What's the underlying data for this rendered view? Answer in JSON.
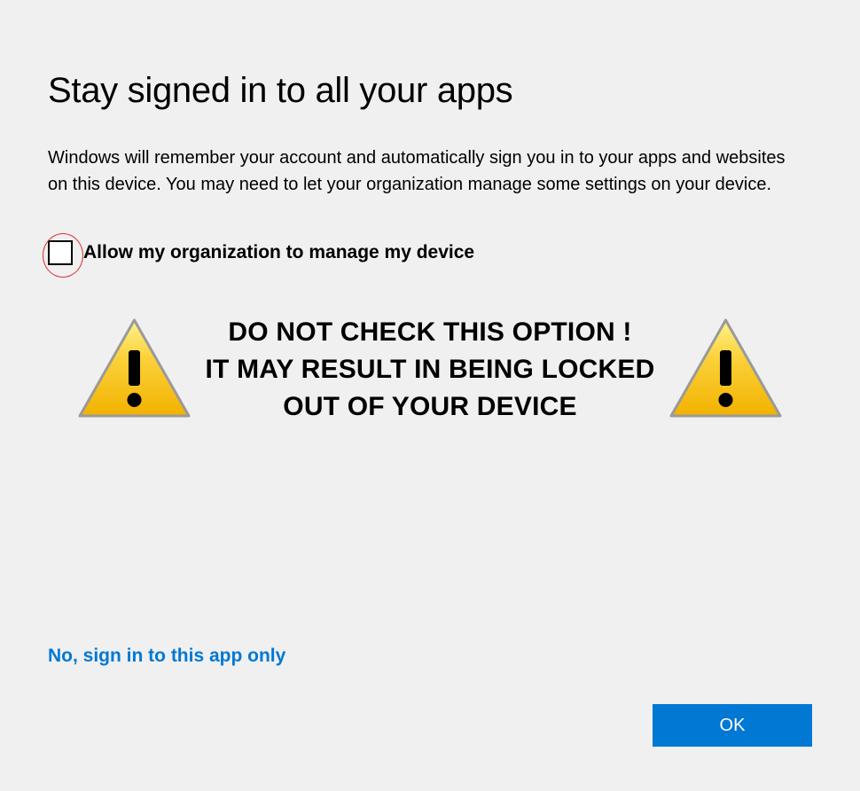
{
  "title": "Stay signed in to all your apps",
  "description": "Windows will remember your account and automatically sign you in to your apps and websites on this device. You may need to let your organization manage some settings on your device.",
  "checkbox": {
    "label": "Allow my organization to manage my device",
    "checked": false
  },
  "warning": {
    "line1": "DO NOT CHECK THIS OPTION !",
    "line2": "IT MAY RESULT IN BEING LOCKED OUT OF  YOUR DEVICE"
  },
  "link": "No, sign in to this app only",
  "okButton": "OK",
  "colors": {
    "accent": "#0078d4",
    "highlight": "#e03030",
    "warningFill": "#f9c300"
  }
}
